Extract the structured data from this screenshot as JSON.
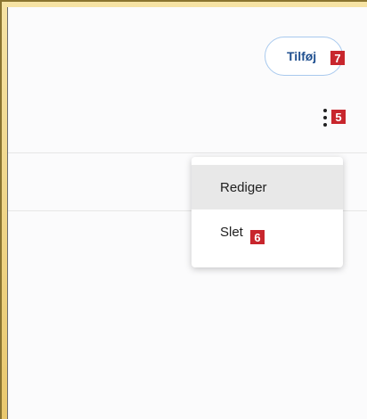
{
  "header": {
    "add_button_label": "Tilføj",
    "add_button_badge": "7",
    "more_badge": "5"
  },
  "menu": {
    "items": [
      {
        "label": "Rediger"
      },
      {
        "label": "Slet",
        "badge": "6"
      }
    ]
  }
}
